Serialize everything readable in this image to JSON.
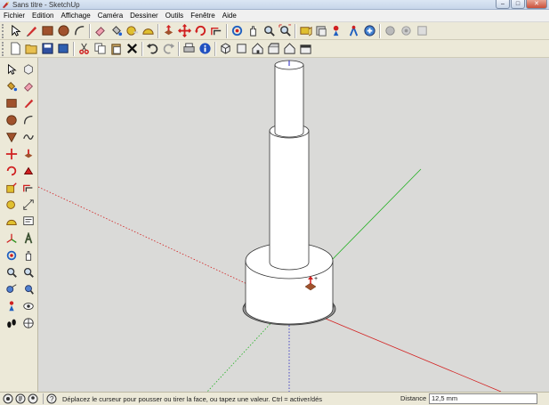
{
  "window": {
    "title": "Sans titre - SketchUp",
    "minimize": "–",
    "maximize": "□",
    "close": "✕"
  },
  "menu": [
    "Fichier",
    "Edition",
    "Affichage",
    "Caméra",
    "Dessiner",
    "Outils",
    "Fenêtre",
    "Aide"
  ],
  "toolbar_icons_row1": [
    "select-icon",
    "pencil-icon",
    "rectangle-icon",
    "circle-icon",
    "arc-icon",
    "eraser-icon",
    "paint-bucket-icon",
    "tape-measure-icon",
    "push-pull-icon",
    "move-icon",
    "rotate-icon",
    "offset-icon",
    "orbit-icon",
    "pan-icon",
    "zoom-icon",
    "zoom-extents-icon",
    "section-icon",
    "walk-icon",
    "position-camera-icon",
    "look-around-icon",
    "component-icon",
    "materials-icon",
    "shadow-icon",
    "styles-icon"
  ],
  "toolbar_icons_row2": [
    "new-icon",
    "open-icon",
    "save-icon",
    "cut-icon",
    "copy-icon",
    "paste-icon",
    "delete-icon",
    "undo-icon",
    "redo-icon",
    "print-icon",
    "info-icon",
    "iso-view-icon",
    "top-view-icon",
    "front-view-icon",
    "right-view-icon",
    "back-view-icon",
    "left-view-icon"
  ],
  "status": {
    "message": "Déplacez le curseur pour pousser ou tirer la face, ou tapez une valeur. Ctrl = activer/dés",
    "measure_label": "Distance",
    "measure_value": "12,5 mm"
  },
  "colors": {
    "viewport_bg": "#dadad8",
    "axis_red": "#d22020",
    "axis_green": "#20b020",
    "axis_blue": "#2020c0"
  }
}
